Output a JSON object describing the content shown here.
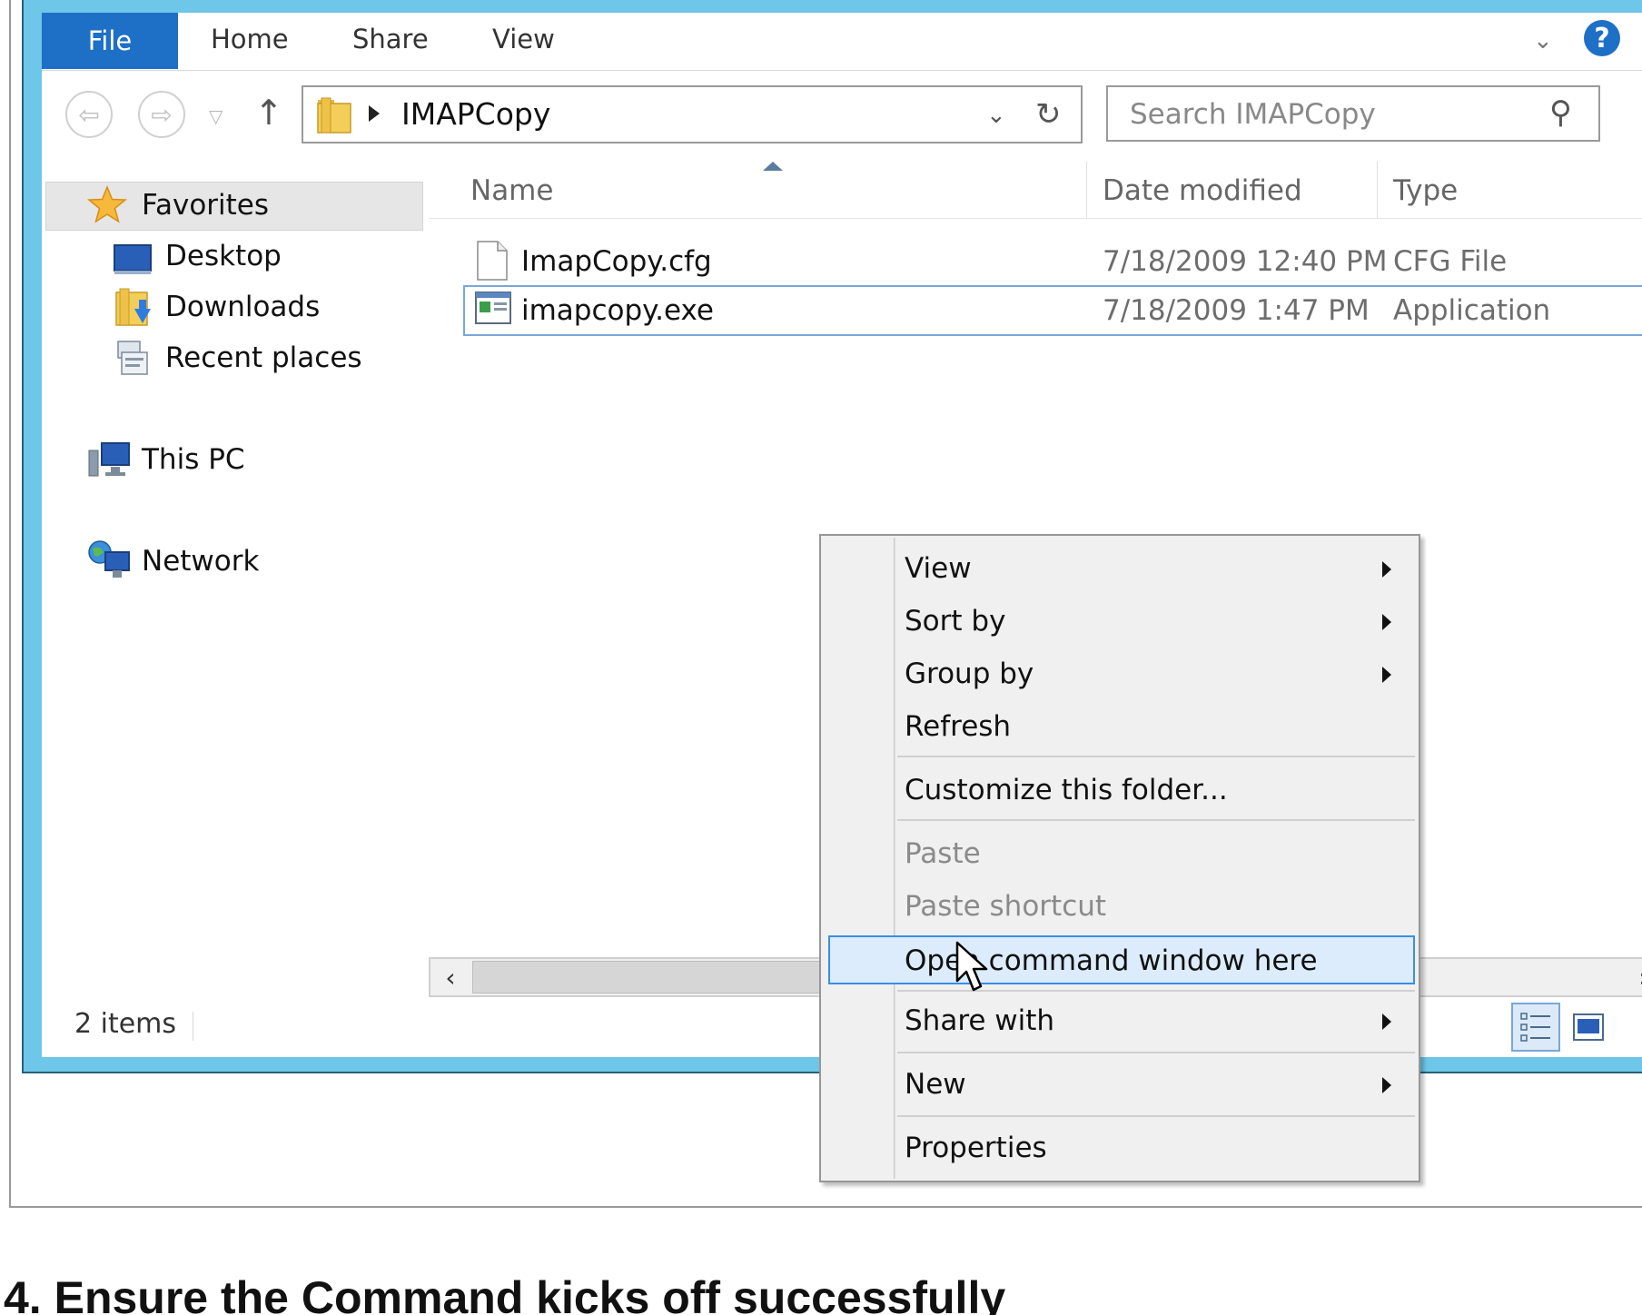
{
  "ribbon": {
    "file_label": "File",
    "tabs": [
      "Home",
      "Share",
      "View"
    ]
  },
  "address": {
    "path": "IMAPCopy",
    "search_placeholder": "Search IMAPCopy"
  },
  "nav": {
    "favorites": "Favorites",
    "items": [
      "Desktop",
      "Downloads",
      "Recent places"
    ],
    "this_pc": "This PC",
    "network": "Network"
  },
  "columns": [
    "Name",
    "Date modified",
    "Type"
  ],
  "files": [
    {
      "name": "ImapCopy.cfg",
      "date": "7/18/2009 12:40 PM",
      "type": "CFG File",
      "selected": false
    },
    {
      "name": "imapcopy.exe",
      "date": "7/18/2009 1:47 PM",
      "type": "Application",
      "selected": true
    }
  ],
  "status": {
    "count": "2 items"
  },
  "context_menu": {
    "items": [
      "View",
      "Sort by",
      "Group by",
      "Refresh",
      "Customize this folder...",
      "Paste",
      "Paste shortcut",
      "Open command window here",
      "Share with",
      "New",
      "Properties"
    ],
    "highlighted": "Open command window here"
  },
  "caption": "4. Ensure the Command kicks off successfully",
  "colors": {
    "accent": "#1e6fc6",
    "window_frame": "#6ec6e8",
    "selection_border": "#7aa7d8",
    "menu_highlight": "#dcecfc"
  }
}
